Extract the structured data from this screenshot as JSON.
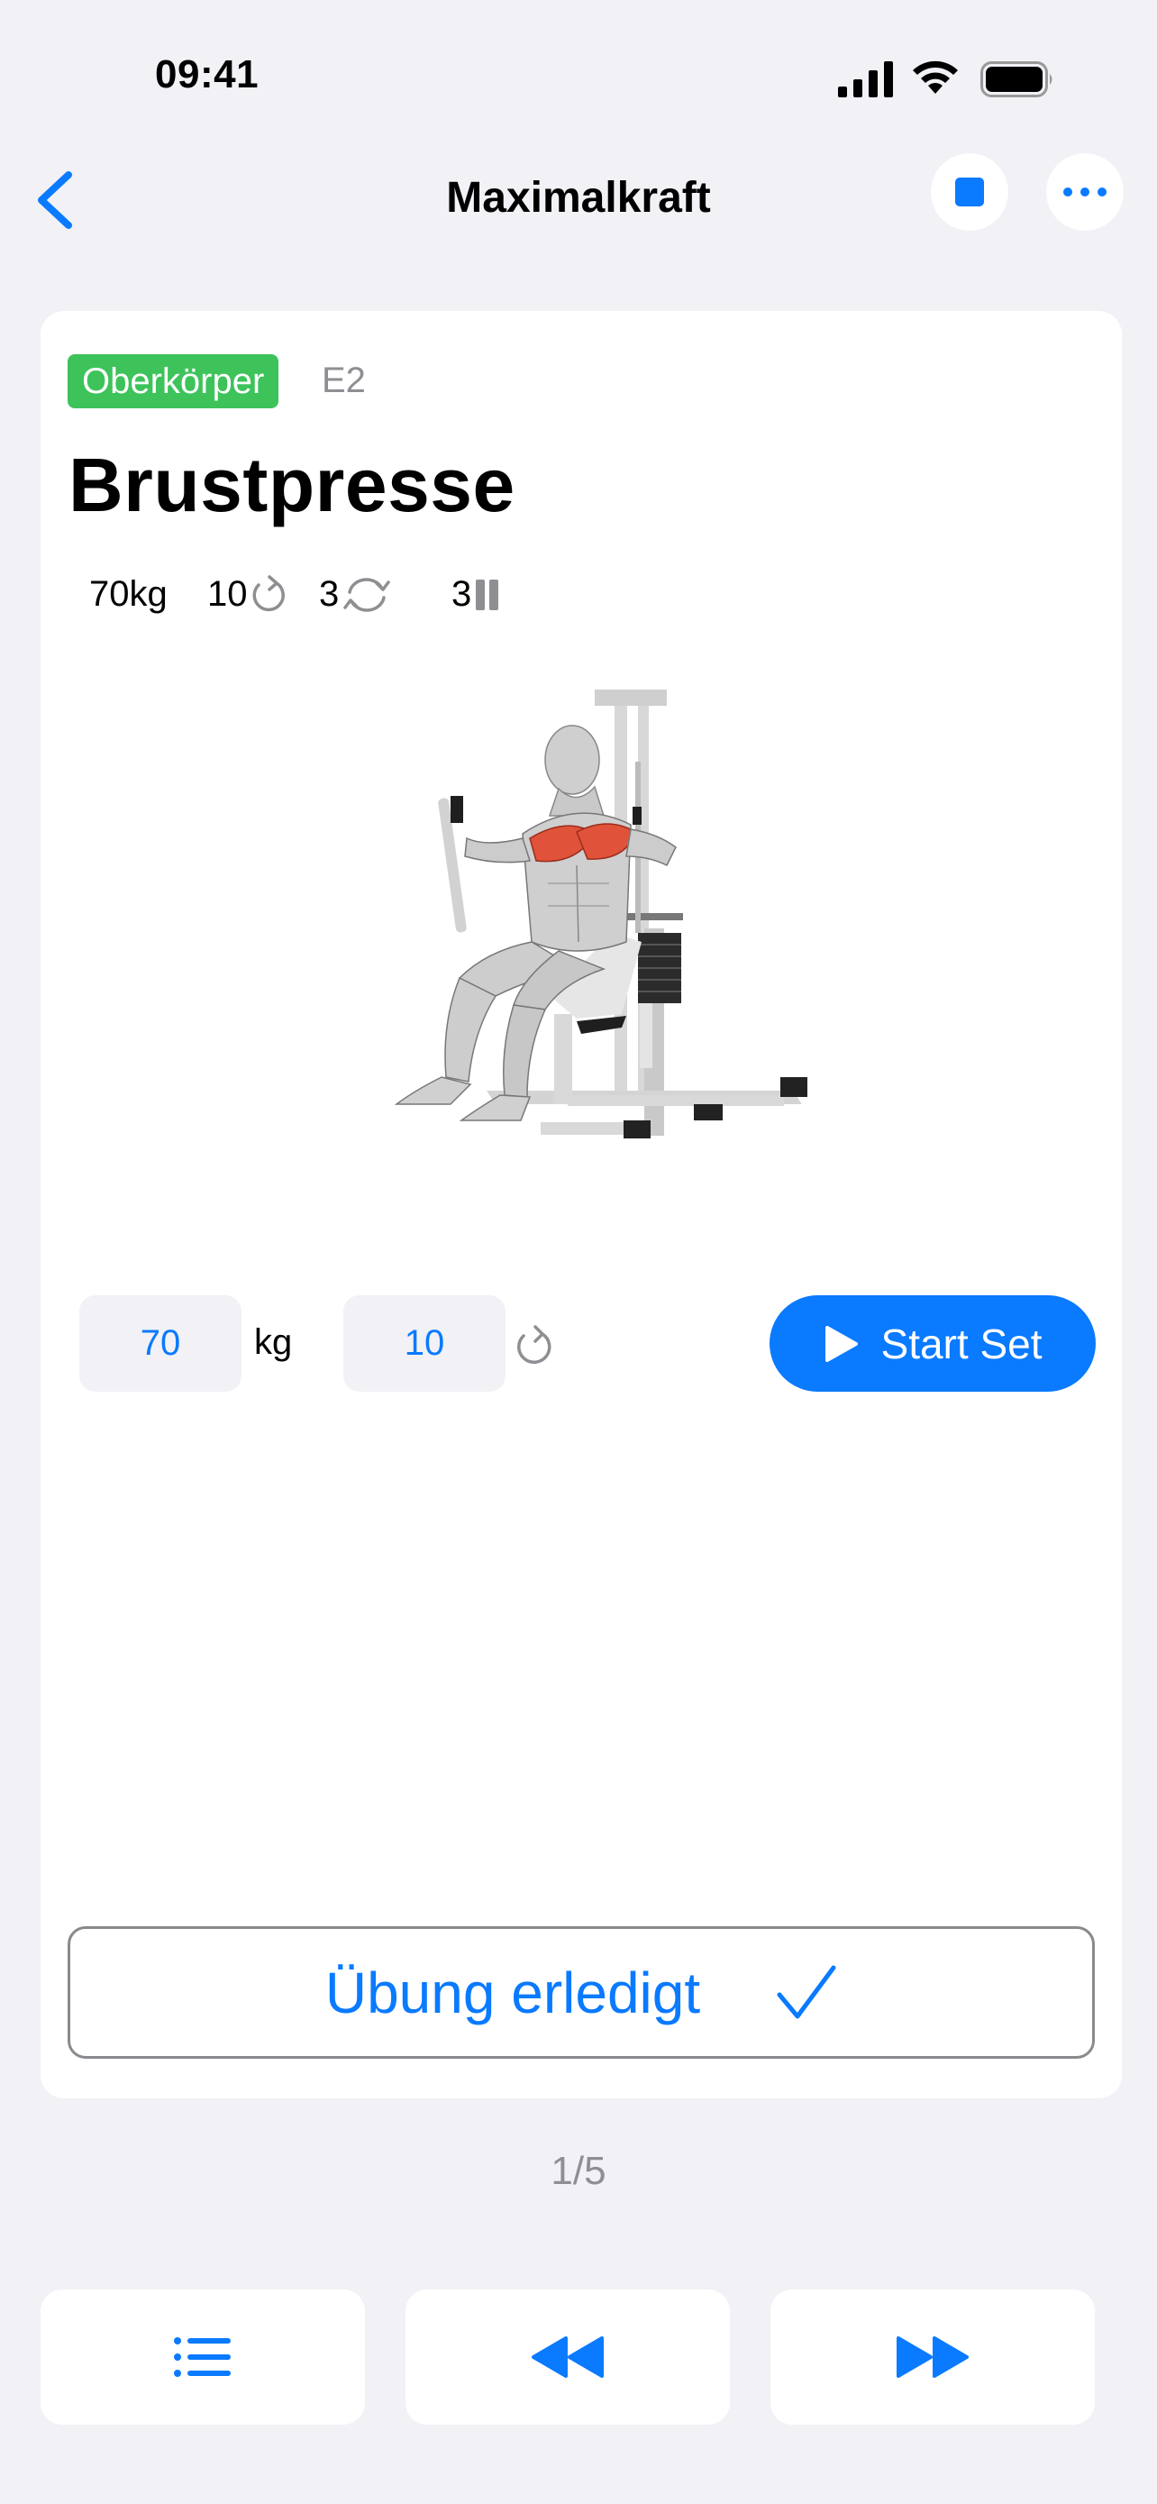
{
  "status_bar": {
    "time": "09:41"
  },
  "nav": {
    "title": "Maximalkraft"
  },
  "exercise": {
    "tag": "Oberkörper",
    "code": "E2",
    "name": "Brustpresse",
    "stats": {
      "weight": "70kg",
      "reps": "10",
      "sets": "3",
      "pauses": "3"
    }
  },
  "inputs": {
    "weight_value": "70",
    "weight_unit": "kg",
    "reps_value": "10"
  },
  "start_button": {
    "label": "Start Set"
  },
  "done_button": {
    "label": "Übung erledigt"
  },
  "pager": "1/5",
  "colors": {
    "accent": "#0a7aff",
    "tag_green": "#3dc35a",
    "background": "#f1f1f6",
    "muscle_highlight": "#e0533a"
  },
  "icons": [
    "back-chevron-icon",
    "stop-icon",
    "more-icon",
    "repeat-icon",
    "sets-cycle-icon",
    "pause-bars-icon",
    "play-icon",
    "checkmark-icon",
    "list-icon",
    "rewind-icon",
    "fast-forward-icon"
  ]
}
